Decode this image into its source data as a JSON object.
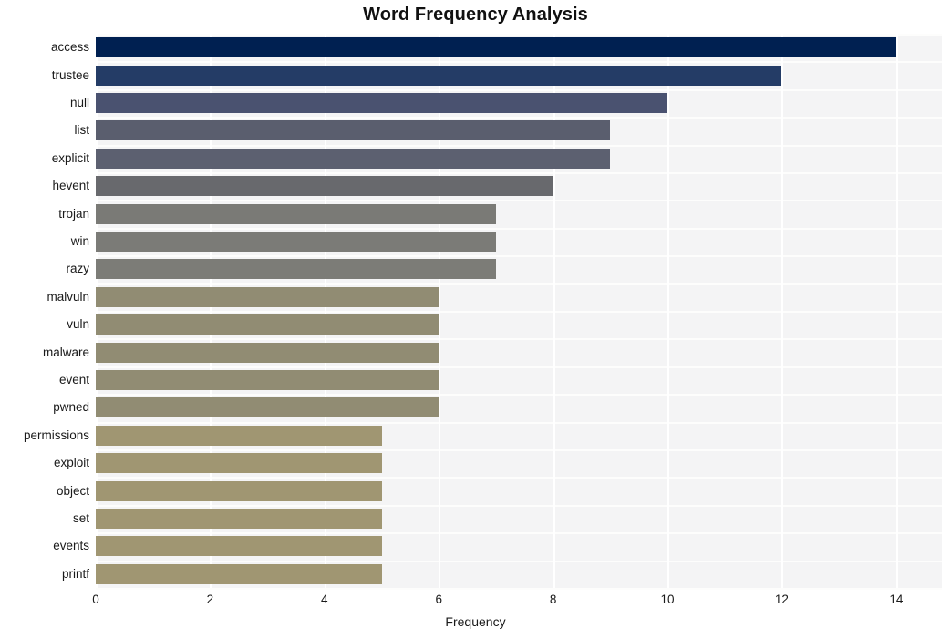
{
  "chart_data": {
    "type": "bar",
    "orientation": "horizontal",
    "title": "Word Frequency Analysis",
    "xlabel": "Frequency",
    "ylabel": "",
    "xlim": [
      0,
      14.8
    ],
    "xticks": [
      "0",
      "2",
      "4",
      "6",
      "8",
      "10",
      "12",
      "14"
    ],
    "xtick_values": [
      0,
      2,
      4,
      6,
      8,
      10,
      12,
      14
    ],
    "grid": "vertical-and-horizontal-white-on-gray",
    "legend": "none",
    "categories": [
      "access",
      "trustee",
      "null",
      "list",
      "explicit",
      "hevent",
      "trojan",
      "win",
      "razy",
      "malvuln",
      "vuln",
      "malware",
      "event",
      "pwned",
      "permissions",
      "exploit",
      "object",
      "set",
      "events",
      "printf"
    ],
    "values": [
      14,
      12,
      10,
      9,
      9,
      8,
      7,
      7,
      7,
      6,
      6,
      6,
      6,
      6,
      5,
      5,
      5,
      5,
      5,
      5
    ],
    "bar_colors": [
      "#002051",
      "#243c६6",
      "#4a5270",
      "#5a5e6e",
      "#5c6070",
      "#68696d",
      "#7a7a76",
      "#7b7b77",
      "#7c7c77",
      "#918c73",
      "#918c73",
      "#918c73",
      "#918c73",
      "#918c73",
      "#a09672",
      "#a09672",
      "#a09672",
      "#a09672",
      "#a09672",
      "#a09672"
    ],
    "colors": {
      "plot_background": "#f4f4f5",
      "figure_background": "#ffffff",
      "gridline": "#ffffff",
      "text": "#1a1a1a",
      "title": "#111111"
    }
  }
}
